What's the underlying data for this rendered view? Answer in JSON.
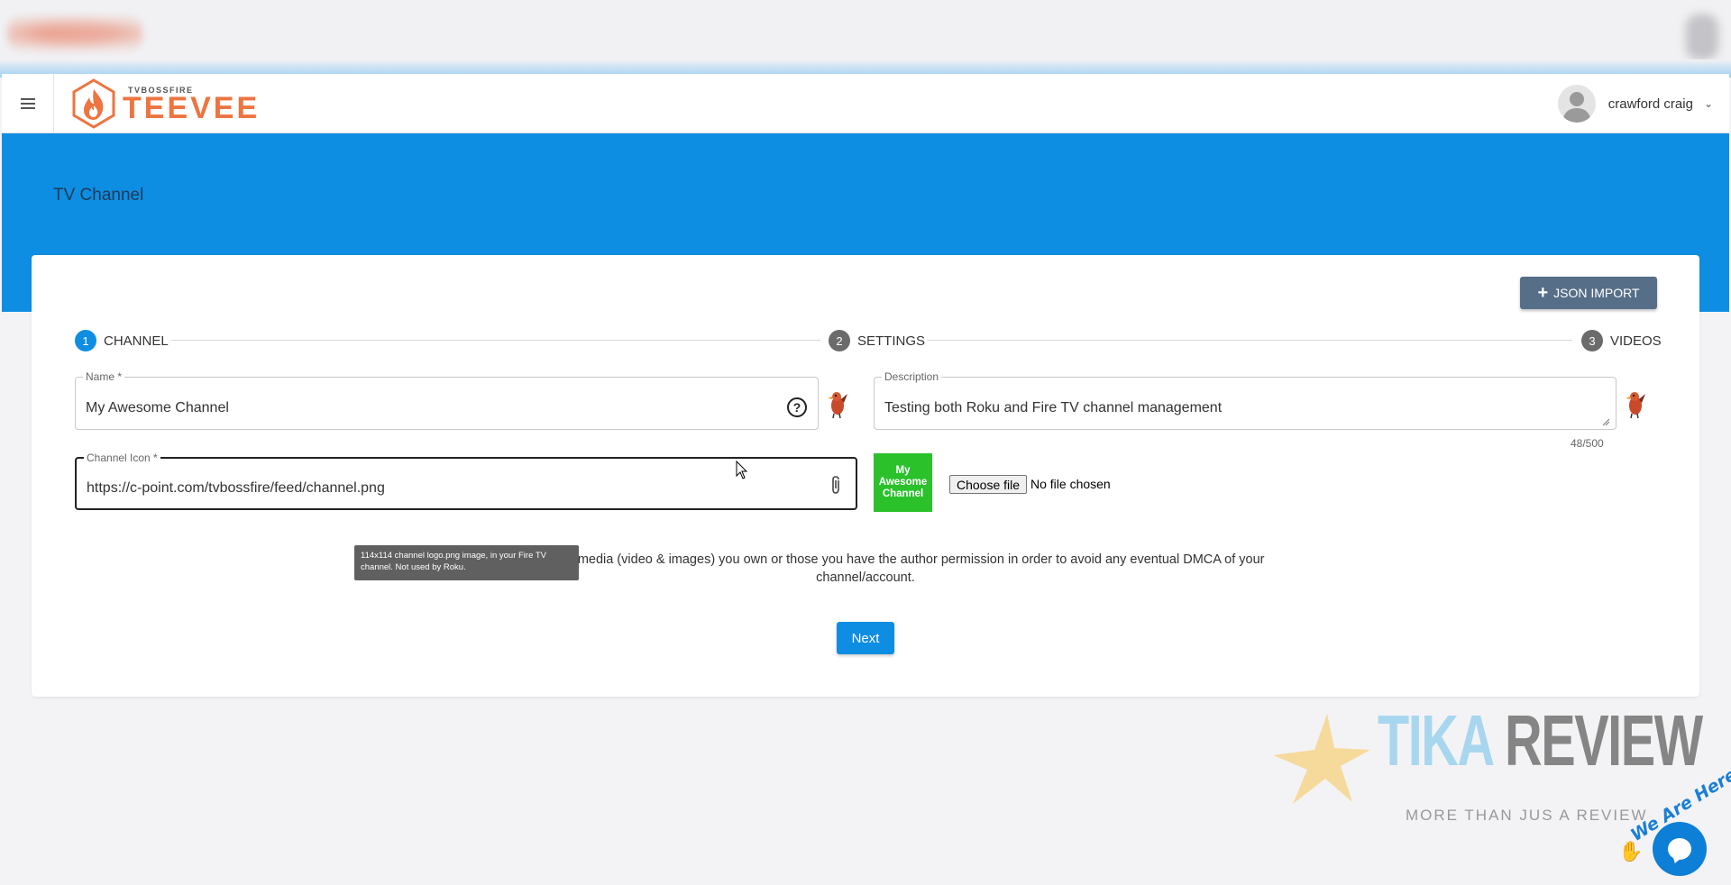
{
  "header": {
    "logo_sub": "TVBOSSFIRE",
    "logo_main": "TEEVEE",
    "user_name": "crawford craig"
  },
  "page": {
    "title": "TV Channel"
  },
  "toolbar": {
    "json_import_label": "JSON IMPORT"
  },
  "stepper": {
    "steps": [
      {
        "num": "1",
        "label": "CHANNEL"
      },
      {
        "num": "2",
        "label": "SETTINGS"
      },
      {
        "num": "3",
        "label": "VIDEOS"
      }
    ]
  },
  "form": {
    "name_label": "Name *",
    "name_value": "My Awesome Channel",
    "description_label": "Description",
    "description_value": "Testing both Roku and Fire TV channel management",
    "description_count": "48/500",
    "icon_label": "Channel Icon *",
    "icon_value": "https://c-point.com/tvbossfire/feed/channel.png",
    "preview_text": "My Awesome Channel",
    "file_button": "Choose file",
    "file_status": "No file chosen",
    "tooltip": "114x114 channel logo.png image, in your Fire TV channel. Not used by Roku.",
    "agree_line1": "I agree to only use media (video & images) you own or those you have the author permission in order to avoid any eventual DMCA of your",
    "agree_line2": "channel/account.",
    "next_label": "Next"
  },
  "watermark": {
    "tika": "TIKA",
    "review": "REVIEW",
    "tagline": "MORE THAN JUS A REVIEW",
    "chat_badge": "We Are Here!"
  },
  "colors": {
    "primary": "#0e8ee2",
    "brand_orange": "#ee7440",
    "json_button": "#566e88",
    "preview_green": "#2bc12b"
  }
}
